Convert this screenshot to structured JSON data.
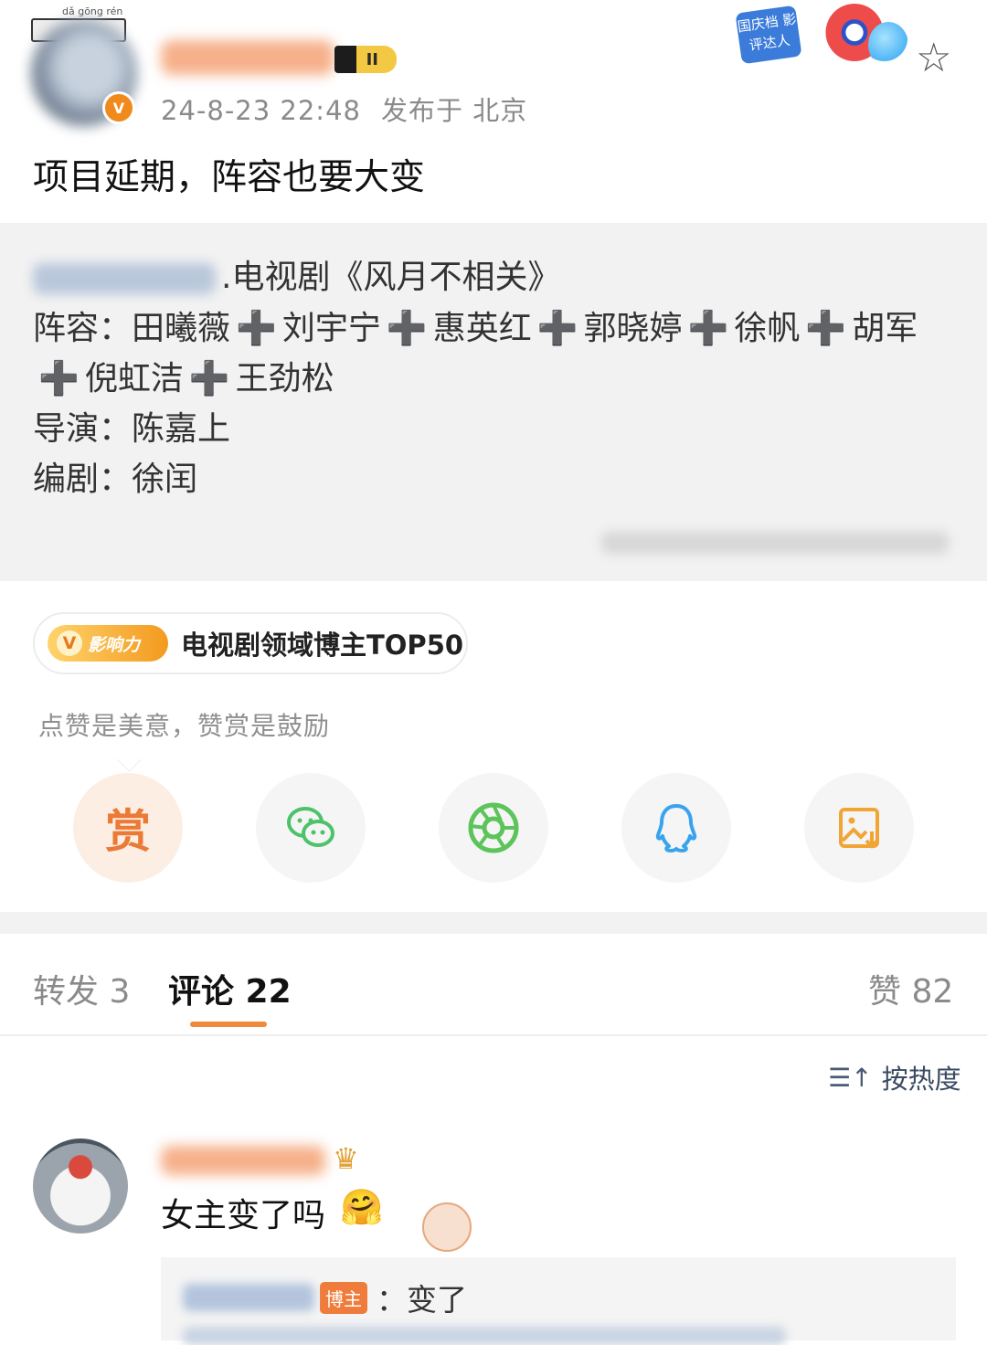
{
  "header": {
    "deco_pinyin": "dǎ gōng rén",
    "rank_badge": "II",
    "timestamp": "24-8-23 22:48",
    "location": "发布于 北京",
    "banner_text": "国庆档 影评达人"
  },
  "post": {
    "text": "项目延期，阵容也要大变"
  },
  "repost": {
    "title": ".电视剧《风月不相关》",
    "cast_label": "阵容：",
    "cast": [
      "田曦薇",
      "刘宇宁",
      "惠英红",
      "郭晓婷",
      "徐帆",
      "胡军",
      "倪虹洁",
      "王劲松"
    ],
    "plus": "➕",
    "director_label": "导演：",
    "director": "陈嘉上",
    "writer_label": "编剧：",
    "writer": "徐闰"
  },
  "influence": {
    "tag": "影响力",
    "tag_letter": "V",
    "text": "电视剧领域博主TOP50"
  },
  "reward_tip": "点赞是美意，赞赏是鼓励",
  "share": {
    "reward_label": "赏",
    "icons": [
      "wechat-icon",
      "moments-icon",
      "qq-icon",
      "save-image-icon"
    ]
  },
  "tabs": {
    "repost": "转发 3",
    "comments": "评论 22",
    "likes": "赞 82"
  },
  "sort": {
    "label": "按热度"
  },
  "comment": {
    "text": "女主变了吗",
    "emoji": "🤗",
    "reply_badge": "博主",
    "reply_text": "：变了"
  },
  "colors": {
    "accent": "#ef8a3a",
    "reward_bg": "#fdeee4",
    "repost_bg": "#f2f2f2"
  }
}
